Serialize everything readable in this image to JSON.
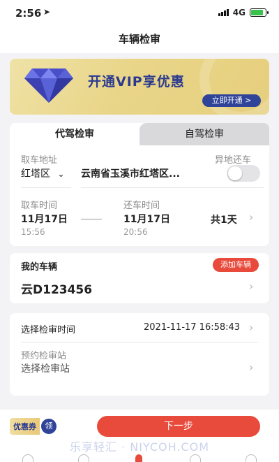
{
  "status": {
    "time": "2:56",
    "network": "4G"
  },
  "nav": {
    "title": "车辆检审"
  },
  "vip": {
    "title": "开通VIP享优惠",
    "button": "立即开通 >"
  },
  "tabs": {
    "active": "代驾检审",
    "inactive": "自驾检审"
  },
  "pickup": {
    "label": "取车地址",
    "district": "红塔区",
    "address": "云南省玉溪市红塔区...",
    "return_other_label": "异地还车"
  },
  "times": {
    "pickup_label": "取车时间",
    "pickup_date": "11月17日",
    "pickup_time": "15:56",
    "return_label": "还车时间",
    "return_date": "11月17日",
    "return_time": "20:56",
    "total": "共1天"
  },
  "car": {
    "title": "我的车辆",
    "add_button": "添加车辆",
    "plate": "云D123456"
  },
  "inspection": {
    "time_label": "选择检审时间",
    "time_value": "2021-11-17 16:58:43",
    "station_label": "预约检审站",
    "station_placeholder": "选择检审站"
  },
  "bottom": {
    "coupon_label": "优惠券",
    "coupon_claim": "领",
    "next_button": "下一步",
    "watermark": "乐享轻汇 · NIYCOH.COM"
  },
  "colors": {
    "accent": "#e84a3b",
    "vip_blue": "#2f4398",
    "vip_gold": "#e9d588"
  }
}
